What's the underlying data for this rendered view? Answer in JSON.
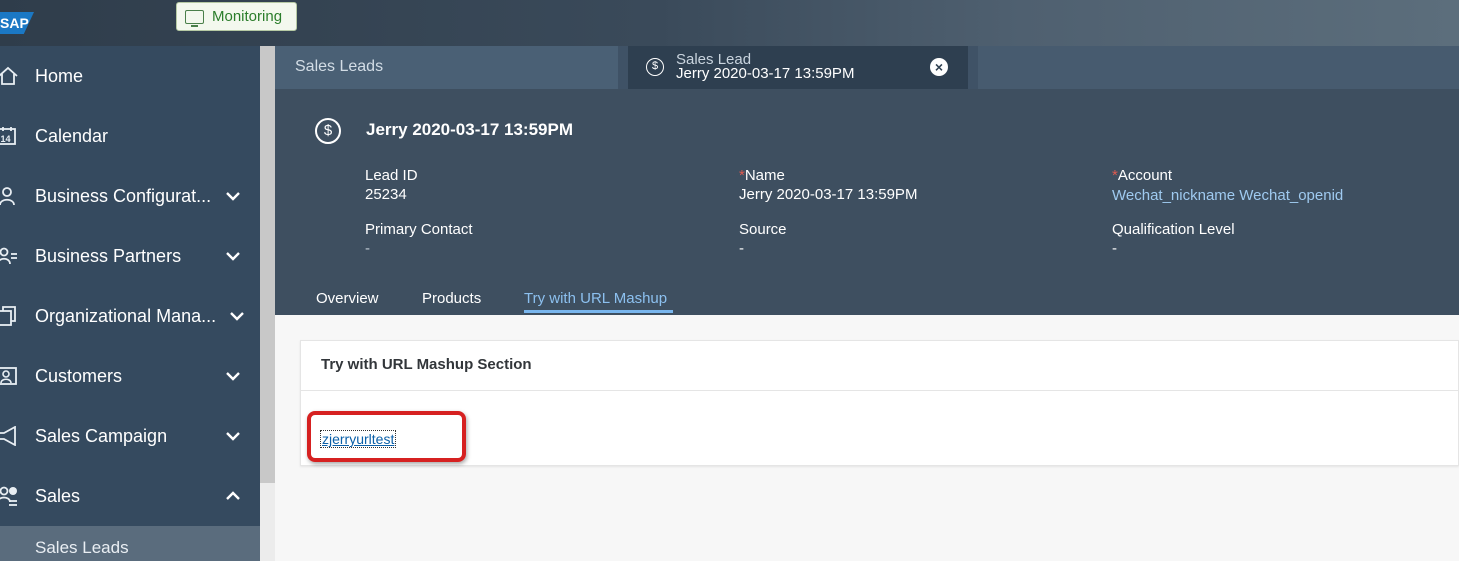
{
  "shell": {
    "logo": "SAP",
    "monitoring_label": "Monitoring"
  },
  "sidebar": {
    "items": [
      {
        "label": "Home",
        "icon": "home-icon"
      },
      {
        "label": "Calendar",
        "icon": "calendar-icon",
        "icon_text": "14"
      },
      {
        "label": "Business Configurat...",
        "icon": "business-config-icon",
        "expand": "down"
      },
      {
        "label": "Business Partners",
        "icon": "business-partners-icon",
        "expand": "down"
      },
      {
        "label": "Organizational Mana...",
        "icon": "org-management-icon",
        "expand": "down"
      },
      {
        "label": "Customers",
        "icon": "customers-icon",
        "expand": "down"
      },
      {
        "label": "Sales Campaign",
        "icon": "campaign-icon",
        "expand": "down"
      },
      {
        "label": "Sales",
        "icon": "sales-icon",
        "expand": "up"
      }
    ],
    "sub_item": "Sales Leads"
  },
  "tabs": {
    "tab1": "Sales Leads",
    "tab2_type": "Sales Lead",
    "tab2_title": "Jerry 2020-03-17 13:59PM"
  },
  "header": {
    "title": "Jerry 2020-03-17 13:59PM",
    "fields": {
      "lead_id_label": "Lead ID",
      "lead_id_value": "25234",
      "name_label": "Name",
      "name_value": "Jerry 2020-03-17 13:59PM",
      "account_label": "Account",
      "account_value": "Wechat_nickname Wechat_openid",
      "primary_contact_label": "Primary Contact",
      "primary_contact_value": "-",
      "source_label": "Source",
      "source_value": "-",
      "qualification_label": "Qualification Level",
      "qualification_value": "-"
    },
    "required_marker": "*"
  },
  "inner_tabs": [
    "Overview",
    "Products",
    "Try with URL Mashup"
  ],
  "section": {
    "title": "Try with URL Mashup Section",
    "link": "zjerryurltest"
  },
  "colors": {
    "sidebar_bg": "#354a5f",
    "header_bg": "#3e4f60",
    "active_tab": "#8cc0ef",
    "highlight_box": "#d62121"
  }
}
